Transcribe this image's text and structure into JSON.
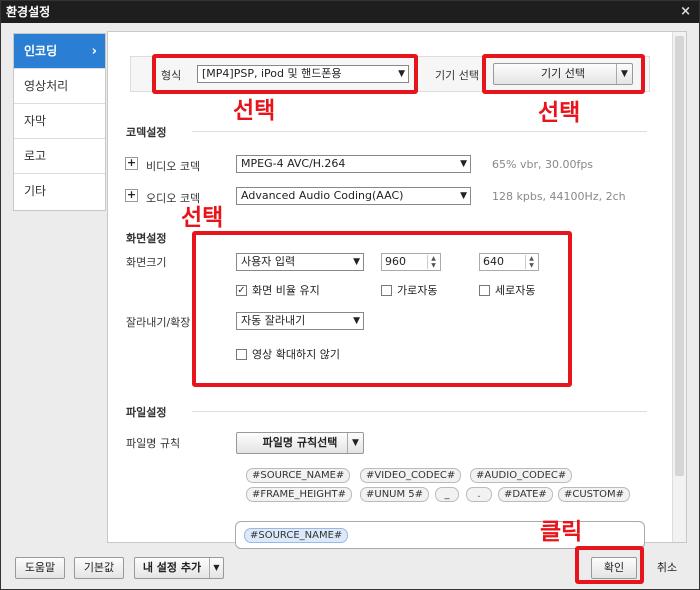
{
  "window": {
    "title": "환경설정",
    "close_label": "×"
  },
  "sidebar": {
    "items": [
      {
        "label": "인코딩",
        "active": true
      },
      {
        "label": "영상처리"
      },
      {
        "label": "자막"
      },
      {
        "label": "로고"
      },
      {
        "label": "기타"
      }
    ],
    "active_chevron": "›"
  },
  "format": {
    "label": "형식",
    "value": "[MP4]PSP, iPod 및 핸드폰용",
    "device_label": "기기 선택",
    "device_button": "기기 선택"
  },
  "codec": {
    "title": "코덱설정",
    "video_label": "비디오 코덱",
    "video_value": "MPEG-4 AVC/H.264",
    "video_info": "65% vbr, 30.00fps",
    "audio_label": "오디오 코덱",
    "audio_value": "Advanced Audio Coding(AAC)",
    "audio_info": "128 kpbs, 44100Hz, 2ch"
  },
  "screen": {
    "title": "화면설정",
    "size_label": "화면크기",
    "size_value": "사용자 입력",
    "width": "960",
    "height": "640",
    "keep_ratio_label": "화면 비율 유지",
    "keep_ratio_checked": true,
    "auto_w_label": "가로자동",
    "auto_h_label": "세로자동",
    "crop_label": "잘라내기/확장",
    "crop_value": "자동 잘라내기",
    "no_upscale_label": "영상 확대하지 않기"
  },
  "file": {
    "title": "파일설정",
    "rule_label": "파일명 규칙",
    "rule_button": "파일명 규칙선택",
    "tags_row1": [
      "#SOURCE_NAME#",
      "#VIDEO_CODEC#",
      "#AUDIO_CODEC#"
    ],
    "tags_row2": [
      "#FRAME_HEIGHT#",
      "#UNUM 5#",
      "_",
      ".",
      "#DATE#",
      "#CUSTOM#"
    ],
    "current_tag": "#SOURCE_NAME#"
  },
  "footer": {
    "help": "도움말",
    "default": "기본값",
    "add_preset": "내 설정 추가",
    "ok": "확인",
    "cancel": "취소"
  },
  "annotations": {
    "select1": "선택",
    "select2": "선택",
    "select3": "선택",
    "click": "클릭",
    "color": "#e8141b"
  },
  "colors": {
    "accent": "#2a7fd4",
    "titlebar": "#1e1e1e"
  }
}
